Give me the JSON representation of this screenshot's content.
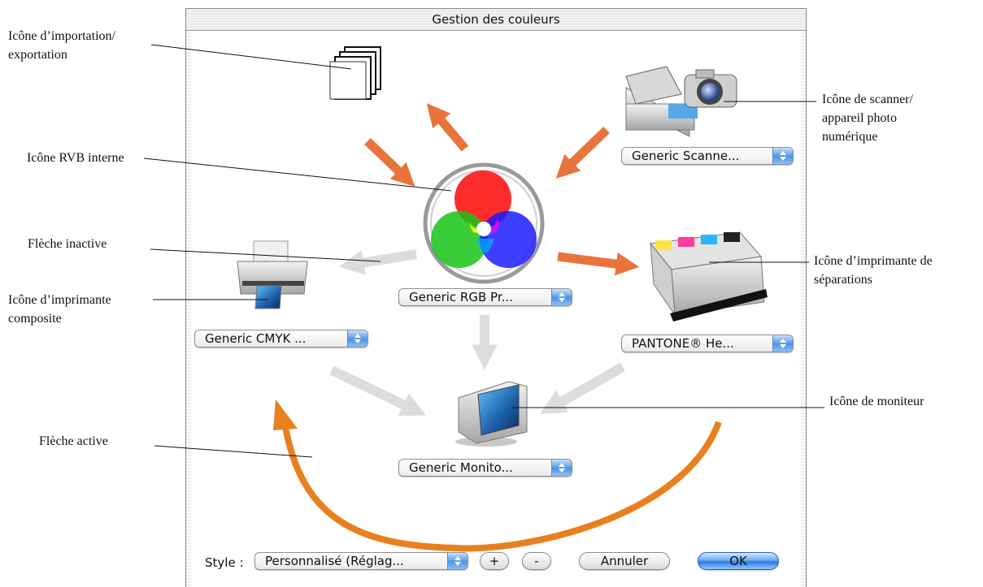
{
  "window": {
    "title": "Gestion des couleurs"
  },
  "popups": {
    "scanner": "Generic Scanne...",
    "rgb": "Generic RGB Pr...",
    "cmyk": "Generic CMYK ...",
    "separation": "PANTONE® He...",
    "monitor": "Generic Monito..."
  },
  "footer": {
    "style_label": "Style :",
    "style_value": "Personnalisé (Réglag...",
    "plus_label": "+",
    "minus_label": "-",
    "cancel_label": "Annuler",
    "ok_label": "OK"
  },
  "callouts": {
    "import_export": "Icône d’importation/\nexportation",
    "scanner": "Icône de scanner/\nappareil photo\nnumérique",
    "rgb": "Icône RVB interne",
    "inactive_arrow": "Flèche inactive",
    "separation_printer": "Icône d’imprimante de\nséparations",
    "composite_printer": "Icône d’imprimante\ncomposite",
    "monitor": "Icône de moniteur",
    "active_arrow": "Flèche active"
  },
  "icons": {
    "import_export": "documents-stack-icon",
    "scanner": "scanner-camera-icon",
    "rgb": "rgb-circles-icon",
    "composite_printer": "inkjet-printer-icon",
    "separation_printer": "press-printer-icon",
    "monitor": "crt-monitor-icon"
  },
  "colors": {
    "active_arrow": "#e8743b",
    "inactive_arrow": "#dcdcdc",
    "red": "#ff1a1a",
    "green": "#18c418",
    "blue": "#1414ff",
    "ok_button": "#3a8ae8"
  }
}
